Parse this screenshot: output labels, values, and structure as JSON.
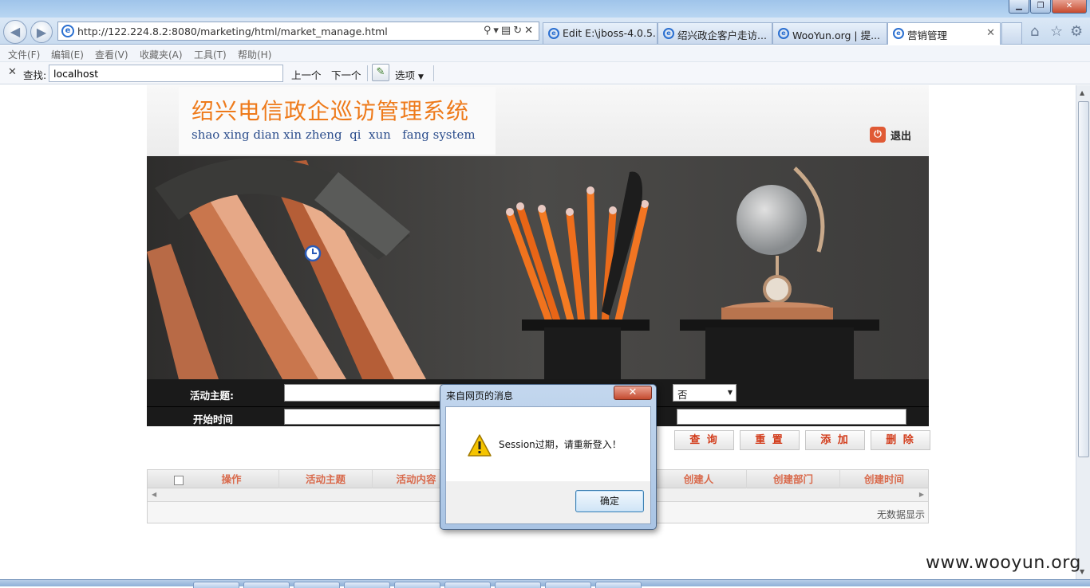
{
  "browser": {
    "url": "http://122.224.8.2:8080/marketing/html/market_manage.html",
    "tabs": [
      {
        "label": "Edit E:\\jboss-4.0.5....",
        "active": false
      },
      {
        "label": "绍兴政企客户走访...",
        "active": false
      },
      {
        "label": "WooYun.org | 提...",
        "active": false
      },
      {
        "label": "营销管理",
        "active": true
      }
    ],
    "menu": [
      "文件(F)",
      "编辑(E)",
      "查看(V)",
      "收藏夹(A)",
      "工具(T)",
      "帮助(H)"
    ],
    "find": {
      "label": "查找:",
      "value": "localhost",
      "prev": "上一个",
      "next": "下一个",
      "options": "选项"
    }
  },
  "site": {
    "title": "绍兴电信政企巡访管理系统",
    "subtitle": "shao xing dian xin zheng  qi  xun   fang system",
    "logout": "退出"
  },
  "form": {
    "topic_label": "活动主题:",
    "start_label": "开始时间",
    "select_value": "否"
  },
  "actions": {
    "query": "查 询",
    "reset": "重 置",
    "add": "添 加",
    "delete": "删 除"
  },
  "grid": {
    "columns": [
      "操作",
      "活动主题",
      "活动内容",
      "创建人",
      "创建部门",
      "创建时间"
    ],
    "empty_text": "无数据显示"
  },
  "dialog": {
    "title": "来自网页的消息",
    "message": "Session过期，请重新登入！",
    "ok": "确定"
  },
  "watermark": "www.wooyun.org",
  "colors": {
    "title_orange": "#ee7a1a",
    "subtitle_blue": "#2b4d8c",
    "button_red": "#d23c1b",
    "column_header": "#d96a4c"
  }
}
